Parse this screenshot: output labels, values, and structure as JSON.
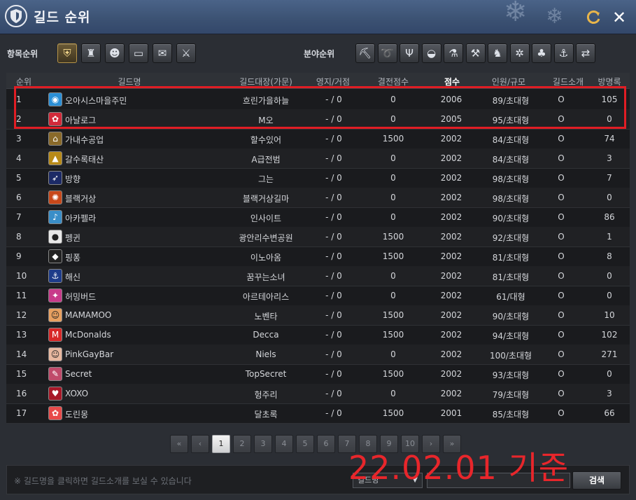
{
  "window": {
    "title": "길드 순위"
  },
  "toolbar": {
    "item_rank_label": "항목순위",
    "field_rank_label": "분야순위",
    "item_categories": [
      {
        "icon": "shield-crest-icon"
      },
      {
        "icon": "flask-icon"
      },
      {
        "icon": "people-icon"
      },
      {
        "icon": "chat-icon"
      },
      {
        "icon": "scroll-icon"
      },
      {
        "icon": "crossed-shield-icon"
      }
    ],
    "field_categories": [
      {
        "icon": "pickaxe-icon"
      },
      {
        "icon": "fish-icon"
      },
      {
        "icon": "deer-icon"
      },
      {
        "icon": "pot-icon"
      },
      {
        "icon": "potion-icon"
      },
      {
        "icon": "hammer-icon"
      },
      {
        "icon": "horse-icon"
      },
      {
        "icon": "wheel-icon"
      },
      {
        "icon": "sprout-icon"
      },
      {
        "icon": "anchor-icon"
      },
      {
        "icon": "trade-arrows-icon"
      }
    ]
  },
  "table": {
    "headers": {
      "rank": "순위",
      "guild_name": "길드명",
      "leader": "길드대장(가문)",
      "territory": "영지/거점",
      "battle_score": "결전점수",
      "score": "점수",
      "members": "인원/규모",
      "intro": "길드소개",
      "guestbook": "방명록"
    },
    "rows": [
      {
        "rank": "1",
        "name": "오아시스마을주민",
        "leader": "흐린가을하늘",
        "territory": "- / 0",
        "battle": "0",
        "score": "2006",
        "members": "89/초대형",
        "intro": "O",
        "guestbook": "105",
        "icon_color": "#2b8fd6",
        "icon_glyph": "◉"
      },
      {
        "rank": "2",
        "name": "아날로그",
        "leader": "M오",
        "territory": "- / 0",
        "battle": "0",
        "score": "2005",
        "members": "95/초대형",
        "intro": "O",
        "guestbook": "0",
        "icon_color": "#d22a3a",
        "icon_glyph": "✿"
      },
      {
        "rank": "3",
        "name": "가내수공업",
        "leader": "할수있어",
        "territory": "- / 0",
        "battle": "1500",
        "score": "2002",
        "members": "84/초대형",
        "intro": "O",
        "guestbook": "74",
        "icon_color": "#8a6a2a",
        "icon_glyph": "⌂"
      },
      {
        "rank": "4",
        "name": "갈수록태산",
        "leader": "A급전범",
        "territory": "- / 0",
        "battle": "0",
        "score": "2002",
        "members": "84/초대형",
        "intro": "O",
        "guestbook": "3",
        "icon_color": "#b88a18",
        "icon_glyph": "▲"
      },
      {
        "rank": "5",
        "name": "방향",
        "leader": "그는",
        "territory": "- / 0",
        "battle": "0",
        "score": "2002",
        "members": "98/초대형",
        "intro": "O",
        "guestbook": "7",
        "icon_color": "#1c2a66",
        "icon_glyph": "➶"
      },
      {
        "rank": "6",
        "name": "블랙거상",
        "leader": "블랙거상길마",
        "territory": "- / 0",
        "battle": "0",
        "score": "2002",
        "members": "98/초대형",
        "intro": "O",
        "guestbook": "0",
        "icon_color": "#c8481a",
        "icon_glyph": "✺"
      },
      {
        "rank": "7",
        "name": "아카펠라",
        "leader": "인사이트",
        "territory": "- / 0",
        "battle": "0",
        "score": "2002",
        "members": "90/초대형",
        "intro": "O",
        "guestbook": "86",
        "icon_color": "#3a8ec8",
        "icon_glyph": "♪"
      },
      {
        "rank": "8",
        "name": "펭귄",
        "leader": "광안리수변공원",
        "territory": "- / 0",
        "battle": "1500",
        "score": "2002",
        "members": "92/초대형",
        "intro": "O",
        "guestbook": "1",
        "icon_color": "#e8e8e8",
        "icon_glyph": "●"
      },
      {
        "rank": "9",
        "name": "핑퐁",
        "leader": "이노아옴",
        "territory": "- / 0",
        "battle": "1500",
        "score": "2002",
        "members": "81/초대형",
        "intro": "O",
        "guestbook": "8",
        "icon_color": "#222222",
        "icon_glyph": "◆"
      },
      {
        "rank": "10",
        "name": "해신",
        "leader": "꿈꾸는소녀",
        "territory": "- / 0",
        "battle": "0",
        "score": "2002",
        "members": "81/초대형",
        "intro": "O",
        "guestbook": "0",
        "icon_color": "#1e3c8a",
        "icon_glyph": "⚓"
      },
      {
        "rank": "11",
        "name": "허밍버드",
        "leader": "아르테아리스",
        "territory": "- / 0",
        "battle": "0",
        "score": "2002",
        "members": "61/대형",
        "intro": "O",
        "guestbook": "0",
        "icon_color": "#c83a8a",
        "icon_glyph": "✦"
      },
      {
        "rank": "12",
        "name": "MAMAMOO",
        "leader": "노벤타",
        "territory": "- / 0",
        "battle": "1500",
        "score": "2002",
        "members": "90/초대형",
        "intro": "O",
        "guestbook": "10",
        "icon_color": "#e8a060",
        "icon_glyph": "☺"
      },
      {
        "rank": "13",
        "name": "McDonalds",
        "leader": "Decca",
        "territory": "- / 0",
        "battle": "1500",
        "score": "2002",
        "members": "94/초대형",
        "intro": "O",
        "guestbook": "102",
        "icon_color": "#d82828",
        "icon_glyph": "M"
      },
      {
        "rank": "14",
        "name": "PinkGayBar",
        "leader": "Niels",
        "territory": "- / 0",
        "battle": "0",
        "score": "2002",
        "members": "100/초대형",
        "intro": "O",
        "guestbook": "271",
        "icon_color": "#e8b8a0",
        "icon_glyph": "☺"
      },
      {
        "rank": "15",
        "name": "Secret",
        "leader": "TopSecret",
        "territory": "- / 0",
        "battle": "1500",
        "score": "2002",
        "members": "93/초대형",
        "intro": "O",
        "guestbook": "0",
        "icon_color": "#c04a6a",
        "icon_glyph": "✎"
      },
      {
        "rank": "16",
        "name": "XOXO",
        "leader": "헝주리",
        "territory": "- / 0",
        "battle": "0",
        "score": "2002",
        "members": "79/초대형",
        "intro": "O",
        "guestbook": "3",
        "icon_color": "#a81828",
        "icon_glyph": "♥"
      },
      {
        "rank": "17",
        "name": "도린몽",
        "leader": "달초록",
        "territory": "- / 0",
        "battle": "1500",
        "score": "2001",
        "members": "85/초대형",
        "intro": "O",
        "guestbook": "66",
        "icon_color": "#e84a4a",
        "icon_glyph": "✿"
      }
    ]
  },
  "pagination": {
    "first": "«",
    "prev": "‹",
    "pages": [
      "1",
      "2",
      "3",
      "4",
      "5",
      "6",
      "7",
      "8",
      "9",
      "10"
    ],
    "current": "1",
    "next": "›",
    "last": "»"
  },
  "footer": {
    "note": "※ 길드명을 클릭하면 길드소개를 보실 수 있습니다",
    "search_type": "길드명",
    "search_value": "",
    "search_button": "검색"
  },
  "overlay": {
    "date_text": "22.02.01 기준"
  },
  "colors": {
    "highlight": "#e11d24",
    "overlay_text": "#e8262b",
    "titlebar": "#3b5172"
  }
}
